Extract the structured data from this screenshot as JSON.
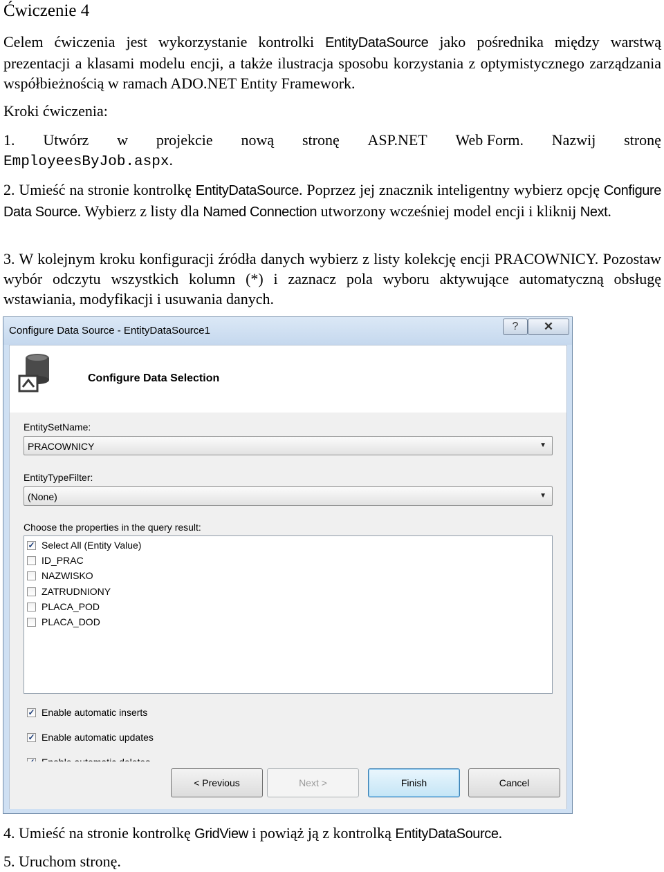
{
  "heading": "Ćwiczenie 4",
  "intro": {
    "t1": "Celem ćwiczenia jest wykorzystanie kontrolki ",
    "t1_ui": "EntityDataSource",
    "t2": " jako pośrednika między warstwą prezentacji a klasami modelu encji, a także ilustracja sposobu korzystania z optymistycznego zarządzania współbieżnością w ramach ADO.NET Entity Framework."
  },
  "steps_label": "Kroki ćwiczenia:",
  "step1": {
    "words": [
      "1.",
      "Utwórz",
      "w",
      "projekcie",
      "nową",
      "stronę",
      "ASP.NET",
      "Web Form.",
      "Nazwij",
      "stronę"
    ],
    "filename": "EmployeesByJob.aspx",
    "end": "."
  },
  "step2": {
    "t1": "2. Umieść na stronie kontrolkę ",
    "ui1": "EntityDataSource",
    "t2": ". Poprzez jej znacznik inteligentny wybierz opcję ",
    "ui2": "Configure Data Source",
    "t3": ". Wybierz z listy dla ",
    "ui3": "Named Connection",
    "t4": " utworzony wcześniej model encji i kliknij ",
    "ui4": "Next",
    "t5": "."
  },
  "step3": {
    "text": "3. W kolejnym kroku konfiguracji źródła danych wybierz z listy kolekcję encji PRACOWNICY. Pozostaw wybór odczytu wszystkich kolumn (*) i zaznacz pola wyboru aktywujące automatyczną obsługę wstawiania, modyfikacji i usuwania danych."
  },
  "dialog": {
    "title": "Configure Data Source - EntityDataSource1",
    "help_label": "?",
    "close_label": "✕",
    "header_title": "Configure Data Selection",
    "entity_set_label": "EntitySetName:",
    "entity_set_value": "PRACOWNICY",
    "entity_type_label": "EntityTypeFilter:",
    "entity_type_value": "(None)",
    "properties_label": "Choose the properties in the query result:",
    "properties": [
      {
        "label": "Select All (Entity Value)",
        "checked": true
      },
      {
        "label": "ID_PRAC",
        "checked": false
      },
      {
        "label": "NAZWISKO",
        "checked": false
      },
      {
        "label": "ZATRUDNIONY",
        "checked": false
      },
      {
        "label": "PLACA_POD",
        "checked": false
      },
      {
        "label": "PLACA_DOD",
        "checked": false
      }
    ],
    "options": [
      {
        "label": "Enable automatic inserts",
        "checked": true
      },
      {
        "label": "Enable automatic updates",
        "checked": true
      },
      {
        "label": "Enable automatic deletes",
        "checked": true
      }
    ],
    "buttons": {
      "previous": "< Previous",
      "next": "Next >",
      "finish": "Finish",
      "cancel": "Cancel"
    }
  },
  "step4": {
    "t1": "4. Umieść na stronie kontrolkę ",
    "ui1": "GridView",
    "t2": " i powiąż ją z kontrolką ",
    "ui2": "EntityDataSource",
    "t3": "."
  },
  "step5": "5. Uruchom stronę."
}
